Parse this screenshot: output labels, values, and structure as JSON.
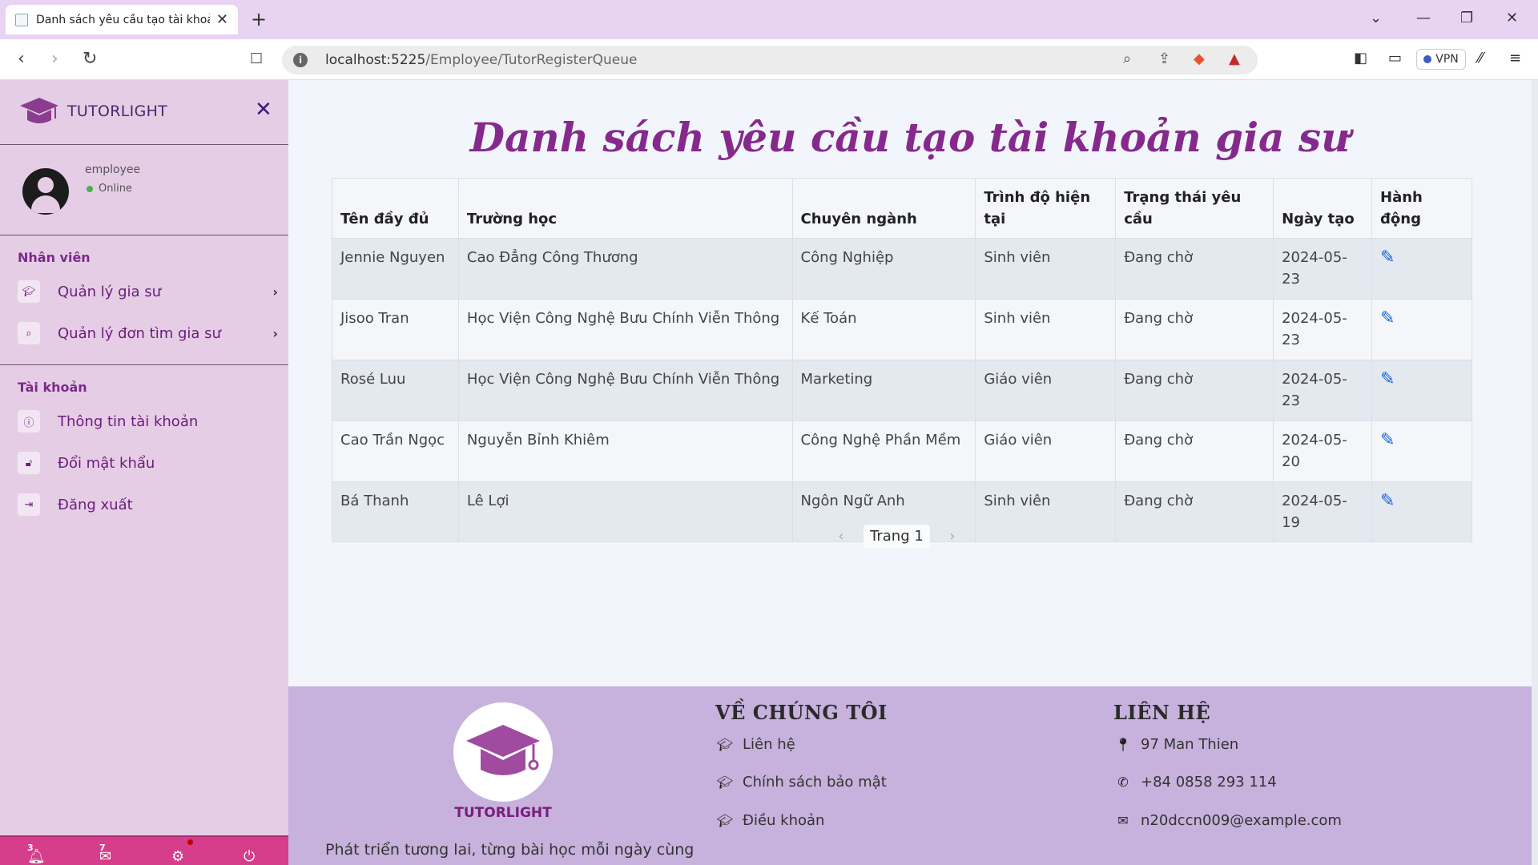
{
  "browser": {
    "tab_title": "Danh sách yêu cầu tạo tài khoản",
    "url_host": "localhost:5225",
    "url_path": "/Employee/TutorRegisterQueue",
    "vpn_label": "VPN"
  },
  "sidebar": {
    "brand": "TUTORLIGHT",
    "user": {
      "name": "employee",
      "status": "Online"
    },
    "sections": [
      {
        "title": "Nhân viên",
        "items": [
          {
            "label": "Quản lý gia sư",
            "icon": "graduation-cap-icon",
            "has_submenu": true
          },
          {
            "label": "Quản lý đơn tìm gia sư",
            "icon": "search-icon",
            "has_submenu": true
          }
        ]
      },
      {
        "title": "Tài khoản",
        "items": [
          {
            "label": "Thông tin tài khoản",
            "icon": "info-icon",
            "has_submenu": false
          },
          {
            "label": "Đổi mật khẩu",
            "icon": "lock-icon",
            "has_submenu": false
          },
          {
            "label": "Đăng xuất",
            "icon": "sign-out-icon",
            "has_submenu": false
          }
        ]
      }
    ],
    "bottom_bar": {
      "notifications": "3",
      "messages": "7"
    }
  },
  "main": {
    "title": "Danh sách yêu cầu tạo tài khoản gia sư",
    "columns": [
      "Tên đầy đủ",
      "Trường học",
      "Chuyên ngành",
      "Trình độ hiện tại",
      "Trạng thái yêu cầu",
      "Ngày tạo",
      "Hành động"
    ],
    "rows": [
      [
        "Jennie Nguyen",
        "Cao Đẳng Công Thương",
        "Công Nghiệp",
        "Sinh viên",
        "Đang chờ",
        "2024-05-23"
      ],
      [
        "Jisoo Tran",
        "Học Viện Công Nghệ Bưu Chính Viễn Thông",
        "Kế Toán",
        "Sinh viên",
        "Đang chờ",
        "2024-05-23"
      ],
      [
        "Rosé Luu",
        "Học Viện Công Nghệ Bưu Chính Viễn Thông",
        "Marketing",
        "Giáo viên",
        "Đang chờ",
        "2024-05-23"
      ],
      [
        "Cao Trần Ngọc",
        "Nguyễn Bỉnh Khiêm",
        "Công Nghệ Phần Mềm",
        "Giáo viên",
        "Đang chờ",
        "2024-05-20"
      ],
      [
        "Bá Thanh",
        "Lê Lợi",
        "Ngôn Ngữ Anh",
        "Sinh viên",
        "Đang chờ",
        "2024-05-19"
      ]
    ],
    "pager_label": "Trang 1"
  },
  "footer": {
    "brand": "TUTORLIGHT",
    "tagline": "Phát triển tương lai, từng bài học mỗi ngày cùng",
    "about": {
      "heading": "VỀ CHÚNG TÔI",
      "links": [
        "Liên hệ",
        "Chính sách bảo mật",
        "Điều khoản"
      ]
    },
    "contact": {
      "heading": "LIÊN HỆ",
      "address": "97 Man Thien",
      "phone": "+84 0858 293 114",
      "email": "n20dccn009@example.com"
    }
  }
}
